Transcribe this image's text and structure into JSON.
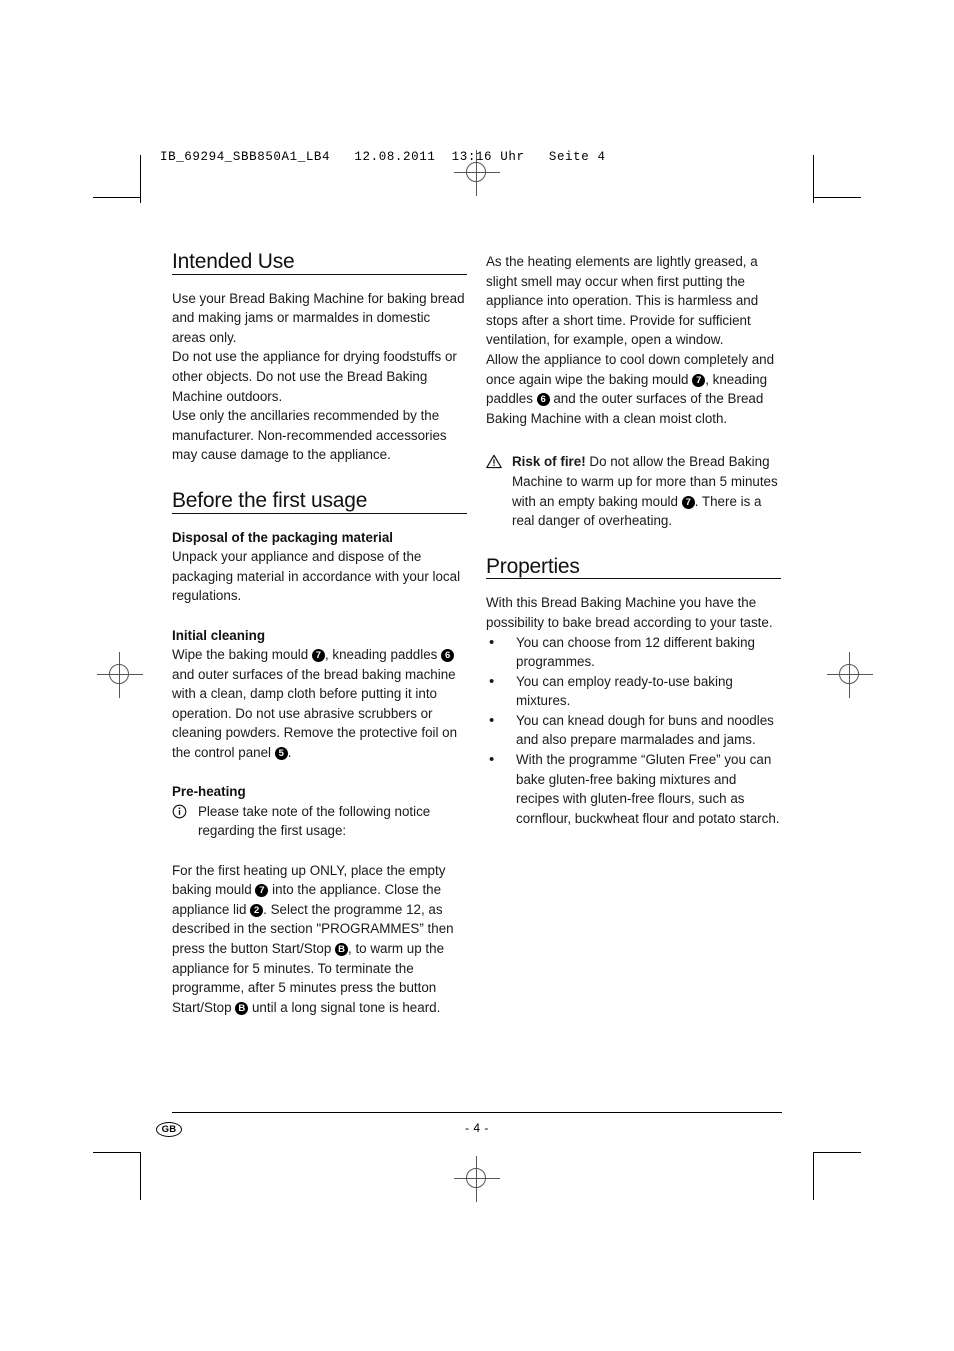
{
  "proof": {
    "slug": "IB_69294_SBB850A1_LB4   12.08.2011  13:16 Uhr   Seite 4"
  },
  "left_column": {
    "intended_use": {
      "heading": "Intended Use",
      "paragraph": "Use your Bread Baking Machine for baking bread and making jams or marmaldes in domestic areas only.\nDo not use the appliance for drying foodstuffs or other objects. Do not use the Bread Baking Machine outdoors.\nUse only the ancillaries recommended by the manufacturer. Non-recommended accessories may cause damage to the appliance."
    },
    "before_first_usage": {
      "heading": "Before the first usage",
      "disposal": {
        "subheading": "Disposal of the packaging material",
        "text": "Unpack your appliance and dispose of the packaging material in accordance with your local regulations."
      },
      "initial_cleaning": {
        "subheading": "Initial cleaning",
        "text_part1": "Wipe the baking mould ",
        "marker1": "7",
        "text_part2": ", kneading paddles ",
        "marker2": "6",
        "text_part3": " and outer surfaces of the bread baking machine with a clean, damp cloth before putting it into operation. Do not use abrasive scrubbers or cleaning powders. Remove the protective foil on the control panel ",
        "marker3": "5",
        "text_part4": "."
      },
      "pre_heating": {
        "subheading": "Pre-heating",
        "notice_icon": "info-circle-icon",
        "notice_text": "Please take note of the following notice regarding the first usage:",
        "body_part1": "For the first heating up ONLY, place the empty baking mould ",
        "marker1": "7",
        "body_part2": " into the appliance. Close the appliance lid ",
        "marker2": "2",
        "body_part3": ". Select the programme 12, as described in the section \"PROGRAMMES” then press the button Start/Stop ",
        "marker3": "B",
        "body_part4": ", to warm up the appliance for 5 minutes. To terminate the programme, after 5 minutes press the button Start/Stop ",
        "marker4": "B",
        "body_part5": " until a long signal tone is heard."
      }
    }
  },
  "right_column": {
    "intro": {
      "paragraph1": "As the heating elements are lightly greased, a slight smell may occur when first putting the appliance into operation. This is harmless and stops after a short time. Provide for sufficient ventilation, for example, open a window.",
      "paragraph2_part1": " Allow the appliance to cool down completely and once again wipe the baking mould ",
      "marker1": "7",
      "paragraph2_part2": ", kneading paddles ",
      "marker2": "6",
      "paragraph2_part3": " and the outer surfaces of the Bread Baking Machine with a clean moist cloth."
    },
    "warning": {
      "icon": "warning-triangle-icon",
      "title": "Risk of fire!",
      "text_part1": " Do not allow the Bread Baking Machine to warm up for more than 5 minutes with an empty baking mould ",
      "marker": "7",
      "text_part2": ". There is a real danger of overheating."
    },
    "properties": {
      "heading": "Properties",
      "intro": "With this Bread Baking Machine you have the possibility to bake bread according to your taste.",
      "bullets": [
        "You can choose from 12 different baking programmes.",
        "You can employ ready-to-use baking mixtures.",
        "You can knead dough for buns and noodles and also prepare marmalades and jams.",
        " With the programme “Gluten Free” you can bake gluten-free baking mixtures and recipes with gluten-free flours, such as cornflour, buckwheat flour and potato starch."
      ],
      "bullet_glyph": "•"
    }
  },
  "footer": {
    "language_badge": "GB",
    "page_number": "- 4 -"
  }
}
